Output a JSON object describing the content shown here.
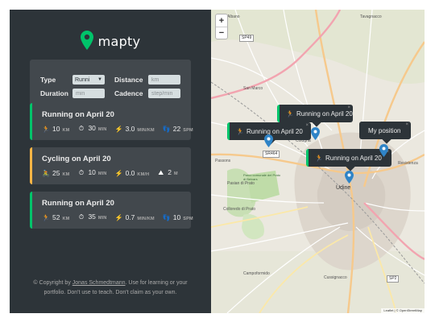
{
  "logo": {
    "text": "mapty"
  },
  "form": {
    "type_label": "Type",
    "type_value": "Runni",
    "distance_label": "Distance",
    "distance_placeholder": "km",
    "duration_label": "Duration",
    "duration_placeholder": "min",
    "cadence_label": "Cadence",
    "cadence_placeholder": "step/min"
  },
  "workouts": [
    {
      "title": "Running on April 20",
      "kind": "running",
      "distance": "10",
      "distance_unit": "KM",
      "duration": "30",
      "duration_unit": "MIN",
      "pace": "3.0",
      "pace_unit": "MIN/KM",
      "extra": "22",
      "extra_unit": "SPM"
    },
    {
      "title": "Cycling on April 20",
      "kind": "cycling",
      "distance": "25",
      "distance_unit": "KM",
      "duration": "10",
      "duration_unit": "MIN",
      "pace": "0.0",
      "pace_unit": "KM/H",
      "extra": "2",
      "extra_unit": "M"
    },
    {
      "title": "Running on April 20",
      "kind": "running",
      "distance": "52",
      "distance_unit": "KM",
      "duration": "35",
      "duration_unit": "MIN",
      "pace": "0.7",
      "pace_unit": "MIN/KM",
      "extra": "10",
      "extra_unit": "SPM"
    }
  ],
  "copyright": {
    "prefix": "© Copyright by ",
    "author": "Jonas Schmedtmann",
    "suffix": ". Use for learning or your portfolio. Don't use to teach. Don't claim as your own."
  },
  "map": {
    "zoom_in": "+",
    "zoom_out": "−",
    "popups": {
      "popup1": "Running on April 20",
      "popup2": "Running on April 20",
      "popup3": "Running on April 20",
      "popup4": "My position"
    },
    "close": "×",
    "attribution": "Leaflet | © OpenStreetMap",
    "labels": {
      "albano": "Albano",
      "tavagnacco": "Tavagnacco",
      "udine": "Udine",
      "campoformido": "Campoformido",
      "colugna": "Colugna",
      "resiutta": "Resistenza",
      "sr464": "SR464",
      "sp49": "SP49",
      "sp2": "SP2",
      "pasian": "Pasian di Prato",
      "colloredo": "Colloredo di Prato",
      "prato": "Parco comunale del Prato di Beivars",
      "cussignacco": "Cussignacco",
      "sanmarco": "San Marco",
      "passons": "Passons"
    }
  },
  "colors": {
    "running": "#00c46a",
    "cycling": "#ffb545",
    "sidebar": "#2d3439",
    "card": "#42484d"
  }
}
